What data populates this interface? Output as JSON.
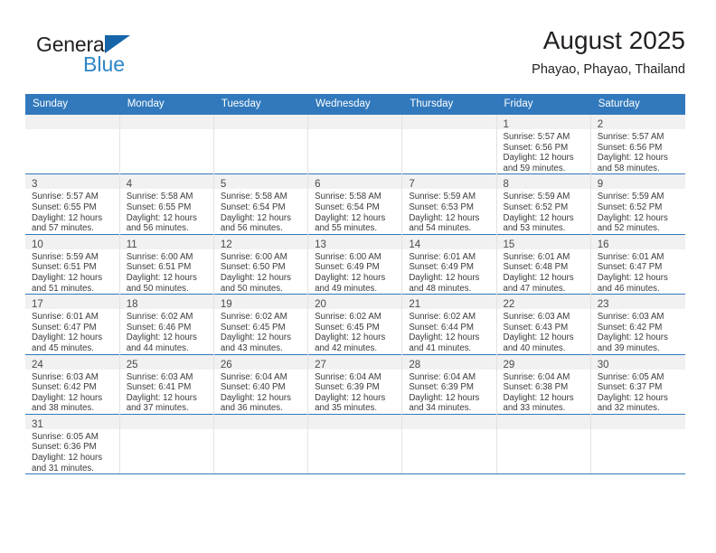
{
  "brand": {
    "name_top": "General",
    "name_bottom": "Blue",
    "triangle_color": "#1565a8",
    "blue_text_color": "#2e86c8"
  },
  "header": {
    "title": "August 2025",
    "subtitle": "Phayao, Phayao, Thailand"
  },
  "theme": {
    "header_blue": "#3179bc",
    "daynum_band": "#f1f1f1",
    "grid_line": "#e2e2e2",
    "text": "#3b3b3b"
  },
  "weekday_headers": [
    "Sunday",
    "Monday",
    "Tuesday",
    "Wednesday",
    "Thursday",
    "Friday",
    "Saturday"
  ],
  "weeks": [
    [
      {
        "day": "",
        "lines": []
      },
      {
        "day": "",
        "lines": []
      },
      {
        "day": "",
        "lines": []
      },
      {
        "day": "",
        "lines": []
      },
      {
        "day": "",
        "lines": []
      },
      {
        "day": "1",
        "lines": [
          "Sunrise: 5:57 AM",
          "Sunset: 6:56 PM",
          "Daylight: 12 hours",
          "and 59 minutes."
        ]
      },
      {
        "day": "2",
        "lines": [
          "Sunrise: 5:57 AM",
          "Sunset: 6:56 PM",
          "Daylight: 12 hours",
          "and 58 minutes."
        ]
      }
    ],
    [
      {
        "day": "3",
        "lines": [
          "Sunrise: 5:57 AM",
          "Sunset: 6:55 PM",
          "Daylight: 12 hours",
          "and 57 minutes."
        ]
      },
      {
        "day": "4",
        "lines": [
          "Sunrise: 5:58 AM",
          "Sunset: 6:55 PM",
          "Daylight: 12 hours",
          "and 56 minutes."
        ]
      },
      {
        "day": "5",
        "lines": [
          "Sunrise: 5:58 AM",
          "Sunset: 6:54 PM",
          "Daylight: 12 hours",
          "and 56 minutes."
        ]
      },
      {
        "day": "6",
        "lines": [
          "Sunrise: 5:58 AM",
          "Sunset: 6:54 PM",
          "Daylight: 12 hours",
          "and 55 minutes."
        ]
      },
      {
        "day": "7",
        "lines": [
          "Sunrise: 5:59 AM",
          "Sunset: 6:53 PM",
          "Daylight: 12 hours",
          "and 54 minutes."
        ]
      },
      {
        "day": "8",
        "lines": [
          "Sunrise: 5:59 AM",
          "Sunset: 6:52 PM",
          "Daylight: 12 hours",
          "and 53 minutes."
        ]
      },
      {
        "day": "9",
        "lines": [
          "Sunrise: 5:59 AM",
          "Sunset: 6:52 PM",
          "Daylight: 12 hours",
          "and 52 minutes."
        ]
      }
    ],
    [
      {
        "day": "10",
        "lines": [
          "Sunrise: 5:59 AM",
          "Sunset: 6:51 PM",
          "Daylight: 12 hours",
          "and 51 minutes."
        ]
      },
      {
        "day": "11",
        "lines": [
          "Sunrise: 6:00 AM",
          "Sunset: 6:51 PM",
          "Daylight: 12 hours",
          "and 50 minutes."
        ]
      },
      {
        "day": "12",
        "lines": [
          "Sunrise: 6:00 AM",
          "Sunset: 6:50 PM",
          "Daylight: 12 hours",
          "and 50 minutes."
        ]
      },
      {
        "day": "13",
        "lines": [
          "Sunrise: 6:00 AM",
          "Sunset: 6:49 PM",
          "Daylight: 12 hours",
          "and 49 minutes."
        ]
      },
      {
        "day": "14",
        "lines": [
          "Sunrise: 6:01 AM",
          "Sunset: 6:49 PM",
          "Daylight: 12 hours",
          "and 48 minutes."
        ]
      },
      {
        "day": "15",
        "lines": [
          "Sunrise: 6:01 AM",
          "Sunset: 6:48 PM",
          "Daylight: 12 hours",
          "and 47 minutes."
        ]
      },
      {
        "day": "16",
        "lines": [
          "Sunrise: 6:01 AM",
          "Sunset: 6:47 PM",
          "Daylight: 12 hours",
          "and 46 minutes."
        ]
      }
    ],
    [
      {
        "day": "17",
        "lines": [
          "Sunrise: 6:01 AM",
          "Sunset: 6:47 PM",
          "Daylight: 12 hours",
          "and 45 minutes."
        ]
      },
      {
        "day": "18",
        "lines": [
          "Sunrise: 6:02 AM",
          "Sunset: 6:46 PM",
          "Daylight: 12 hours",
          "and 44 minutes."
        ]
      },
      {
        "day": "19",
        "lines": [
          "Sunrise: 6:02 AM",
          "Sunset: 6:45 PM",
          "Daylight: 12 hours",
          "and 43 minutes."
        ]
      },
      {
        "day": "20",
        "lines": [
          "Sunrise: 6:02 AM",
          "Sunset: 6:45 PM",
          "Daylight: 12 hours",
          "and 42 minutes."
        ]
      },
      {
        "day": "21",
        "lines": [
          "Sunrise: 6:02 AM",
          "Sunset: 6:44 PM",
          "Daylight: 12 hours",
          "and 41 minutes."
        ]
      },
      {
        "day": "22",
        "lines": [
          "Sunrise: 6:03 AM",
          "Sunset: 6:43 PM",
          "Daylight: 12 hours",
          "and 40 minutes."
        ]
      },
      {
        "day": "23",
        "lines": [
          "Sunrise: 6:03 AM",
          "Sunset: 6:42 PM",
          "Daylight: 12 hours",
          "and 39 minutes."
        ]
      }
    ],
    [
      {
        "day": "24",
        "lines": [
          "Sunrise: 6:03 AM",
          "Sunset: 6:42 PM",
          "Daylight: 12 hours",
          "and 38 minutes."
        ]
      },
      {
        "day": "25",
        "lines": [
          "Sunrise: 6:03 AM",
          "Sunset: 6:41 PM",
          "Daylight: 12 hours",
          "and 37 minutes."
        ]
      },
      {
        "day": "26",
        "lines": [
          "Sunrise: 6:04 AM",
          "Sunset: 6:40 PM",
          "Daylight: 12 hours",
          "and 36 minutes."
        ]
      },
      {
        "day": "27",
        "lines": [
          "Sunrise: 6:04 AM",
          "Sunset: 6:39 PM",
          "Daylight: 12 hours",
          "and 35 minutes."
        ]
      },
      {
        "day": "28",
        "lines": [
          "Sunrise: 6:04 AM",
          "Sunset: 6:39 PM",
          "Daylight: 12 hours",
          "and 34 minutes."
        ]
      },
      {
        "day": "29",
        "lines": [
          "Sunrise: 6:04 AM",
          "Sunset: 6:38 PM",
          "Daylight: 12 hours",
          "and 33 minutes."
        ]
      },
      {
        "day": "30",
        "lines": [
          "Sunrise: 6:05 AM",
          "Sunset: 6:37 PM",
          "Daylight: 12 hours",
          "and 32 minutes."
        ]
      }
    ],
    [
      {
        "day": "31",
        "lines": [
          "Sunrise: 6:05 AM",
          "Sunset: 6:36 PM",
          "Daylight: 12 hours",
          "and 31 minutes."
        ]
      },
      {
        "day": "",
        "lines": []
      },
      {
        "day": "",
        "lines": []
      },
      {
        "day": "",
        "lines": []
      },
      {
        "day": "",
        "lines": []
      },
      {
        "day": "",
        "lines": []
      },
      {
        "day": "",
        "lines": []
      }
    ]
  ]
}
